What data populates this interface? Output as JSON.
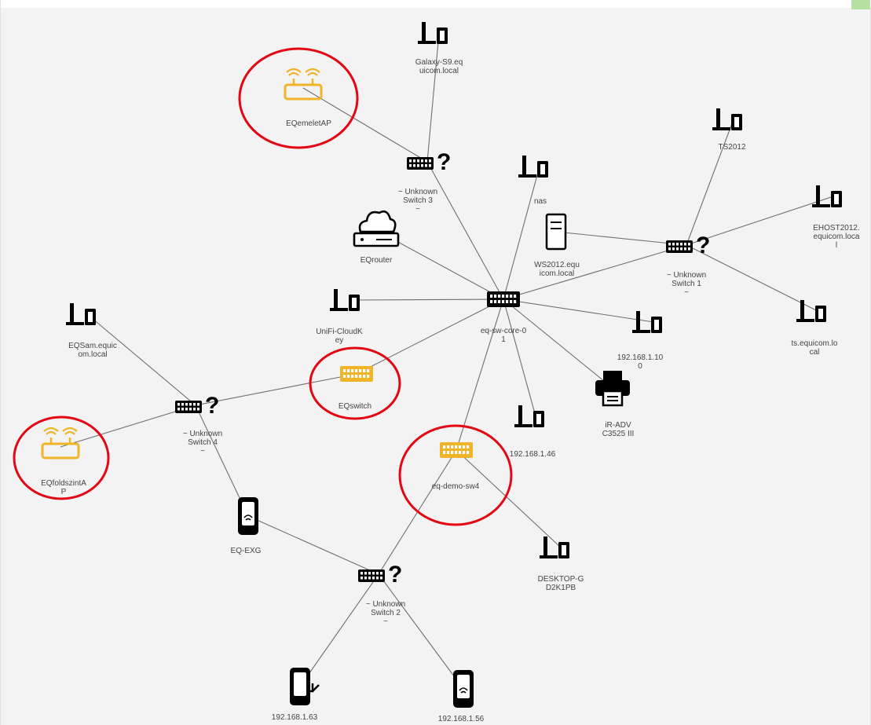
{
  "colors": {
    "device": "#000000",
    "accent": "#f0b429",
    "highlight": "#e30613",
    "edge": "#6f6f6f",
    "label": "#444444",
    "canvas": "#f3f3f3"
  },
  "nodes": [
    {
      "id": "galaxy",
      "type": "laptop",
      "label": [
        "Galaxy-S9.eq",
        "uicom.local"
      ]
    },
    {
      "id": "emeletap",
      "type": "ap",
      "label": [
        "EQemeletAP"
      ]
    },
    {
      "id": "unk3",
      "type": "unknown-switch",
      "label": [
        "~ Unknown",
        "Switch 3",
        "~"
      ]
    },
    {
      "id": "nas",
      "type": "laptop",
      "label": [
        "nas"
      ]
    },
    {
      "id": "ts2012",
      "type": "laptop",
      "label": [
        "TS2012"
      ]
    },
    {
      "id": "ehost",
      "type": "laptop",
      "label": [
        "EHOST2012.",
        "equicom.loca",
        "l"
      ]
    },
    {
      "id": "eqrouter",
      "type": "router",
      "label": [
        "EQrouter"
      ]
    },
    {
      "id": "ws2012",
      "type": "server",
      "label": [
        "WS2012.equ",
        "icom.local"
      ]
    },
    {
      "id": "unk1",
      "type": "unknown-switch",
      "label": [
        "~ Unknown",
        "Switch 1",
        "~"
      ]
    },
    {
      "id": "unifi",
      "type": "laptop",
      "label": [
        "UniFi-CloudK",
        "ey"
      ]
    },
    {
      "id": "core",
      "type": "switch",
      "label": [
        "eq-sw-core-0",
        "1"
      ]
    },
    {
      "id": "ip100",
      "type": "laptop",
      "label": [
        "192.168.1.10",
        "0"
      ]
    },
    {
      "id": "tseq",
      "type": "laptop",
      "label": [
        "ts.equicom.lo",
        "cal"
      ]
    },
    {
      "id": "eqsam",
      "type": "laptop",
      "label": [
        "EQSam.equic",
        "om.local"
      ]
    },
    {
      "id": "eqswitch",
      "type": "switch-accent",
      "label": [
        "EQswitch"
      ]
    },
    {
      "id": "printer",
      "type": "printer",
      "label": [
        "iR-ADV",
        "C3525 III"
      ]
    },
    {
      "id": "unk4",
      "type": "unknown-switch",
      "label": [
        "~ Unknown",
        "Switch 4",
        "~"
      ]
    },
    {
      "id": "ip46",
      "type": "laptop",
      "label": [
        "192.168.1.46"
      ]
    },
    {
      "id": "foldap",
      "type": "ap",
      "label": [
        "EQfoldszintA",
        "P"
      ]
    },
    {
      "id": "demosw",
      "type": "switch-accent",
      "label": [
        "eq-demo-sw4"
      ]
    },
    {
      "id": "exg",
      "type": "handheld-wifi",
      "label": [
        "EQ-EXG"
      ]
    },
    {
      "id": "desktop",
      "type": "laptop",
      "label": [
        "DESKTOP-G",
        "D2K1PB"
      ]
    },
    {
      "id": "unk2",
      "type": "unknown-switch",
      "label": [
        "~ Unknown",
        "Switch 2",
        "~"
      ]
    },
    {
      "id": "ip63",
      "type": "handheld-arrow",
      "label": [
        "192.168.1.63"
      ]
    },
    {
      "id": "ip56",
      "type": "handheld-wifi",
      "label": [
        "192.168.1.56"
      ]
    }
  ],
  "edges": [
    [
      "core",
      "unk3"
    ],
    [
      "unk3",
      "galaxy"
    ],
    [
      "unk3",
      "emeletap"
    ],
    [
      "core",
      "nas"
    ],
    [
      "core",
      "eqrouter"
    ],
    [
      "core",
      "unk1"
    ],
    [
      "unk1",
      "ws2012"
    ],
    [
      "unk1",
      "ts2012"
    ],
    [
      "unk1",
      "ehost"
    ],
    [
      "unk1",
      "tseq"
    ],
    [
      "core",
      "unifi"
    ],
    [
      "core",
      "ip100"
    ],
    [
      "core",
      "printer"
    ],
    [
      "core",
      "ip46"
    ],
    [
      "core",
      "eqswitch"
    ],
    [
      "eqswitch",
      "unk4"
    ],
    [
      "unk4",
      "eqsam"
    ],
    [
      "unk4",
      "foldap"
    ],
    [
      "unk4",
      "exg"
    ],
    [
      "exg",
      "unk2"
    ],
    [
      "unk2",
      "demosw"
    ],
    [
      "core",
      "demosw"
    ],
    [
      "demosw",
      "desktop"
    ],
    [
      "unk2",
      "ip63"
    ],
    [
      "unk2",
      "ip56"
    ]
  ],
  "highlighted": [
    "emeletap",
    "eqswitch",
    "foldap",
    "demosw"
  ]
}
